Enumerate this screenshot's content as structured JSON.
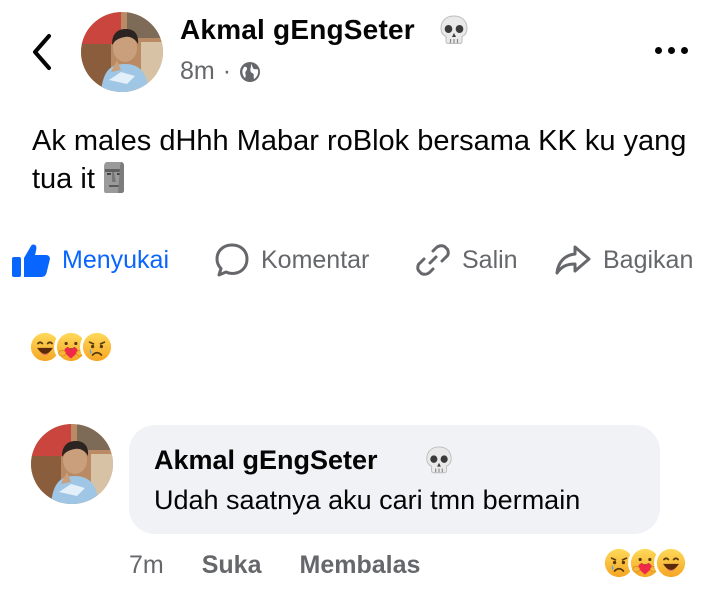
{
  "post": {
    "author_name": "Akmal gEngSeter",
    "name_emoji": "skull-emoji",
    "time": "8m",
    "separator": "·",
    "privacy_icon": "globe-icon",
    "text": "Ak males dHhh Mabar roBlok bersama KK ku yang tua it",
    "text_emoji": "moai-emoji"
  },
  "actions": {
    "like_label": "Menyukai",
    "comment_label": "Komentar",
    "copy_label": "Salin",
    "share_label": "Bagikan"
  },
  "reactions": [
    "haha-reaction",
    "care-reaction",
    "sad-reaction"
  ],
  "comment": {
    "author_name": "Akmal gEngSeter",
    "name_emoji": "skull-emoji",
    "text": "Udah saatnya aku cari tmn bermain",
    "time": "7m",
    "like_label": "Suka",
    "reply_label": "Membalas",
    "reactions": [
      "sad-reaction",
      "care-reaction",
      "haha-reaction"
    ]
  },
  "colors": {
    "accent": "#0866ff",
    "secondary_text": "#65676b",
    "bubble": "#f0f2f5",
    "reaction_yellow": "#f7b125"
  }
}
